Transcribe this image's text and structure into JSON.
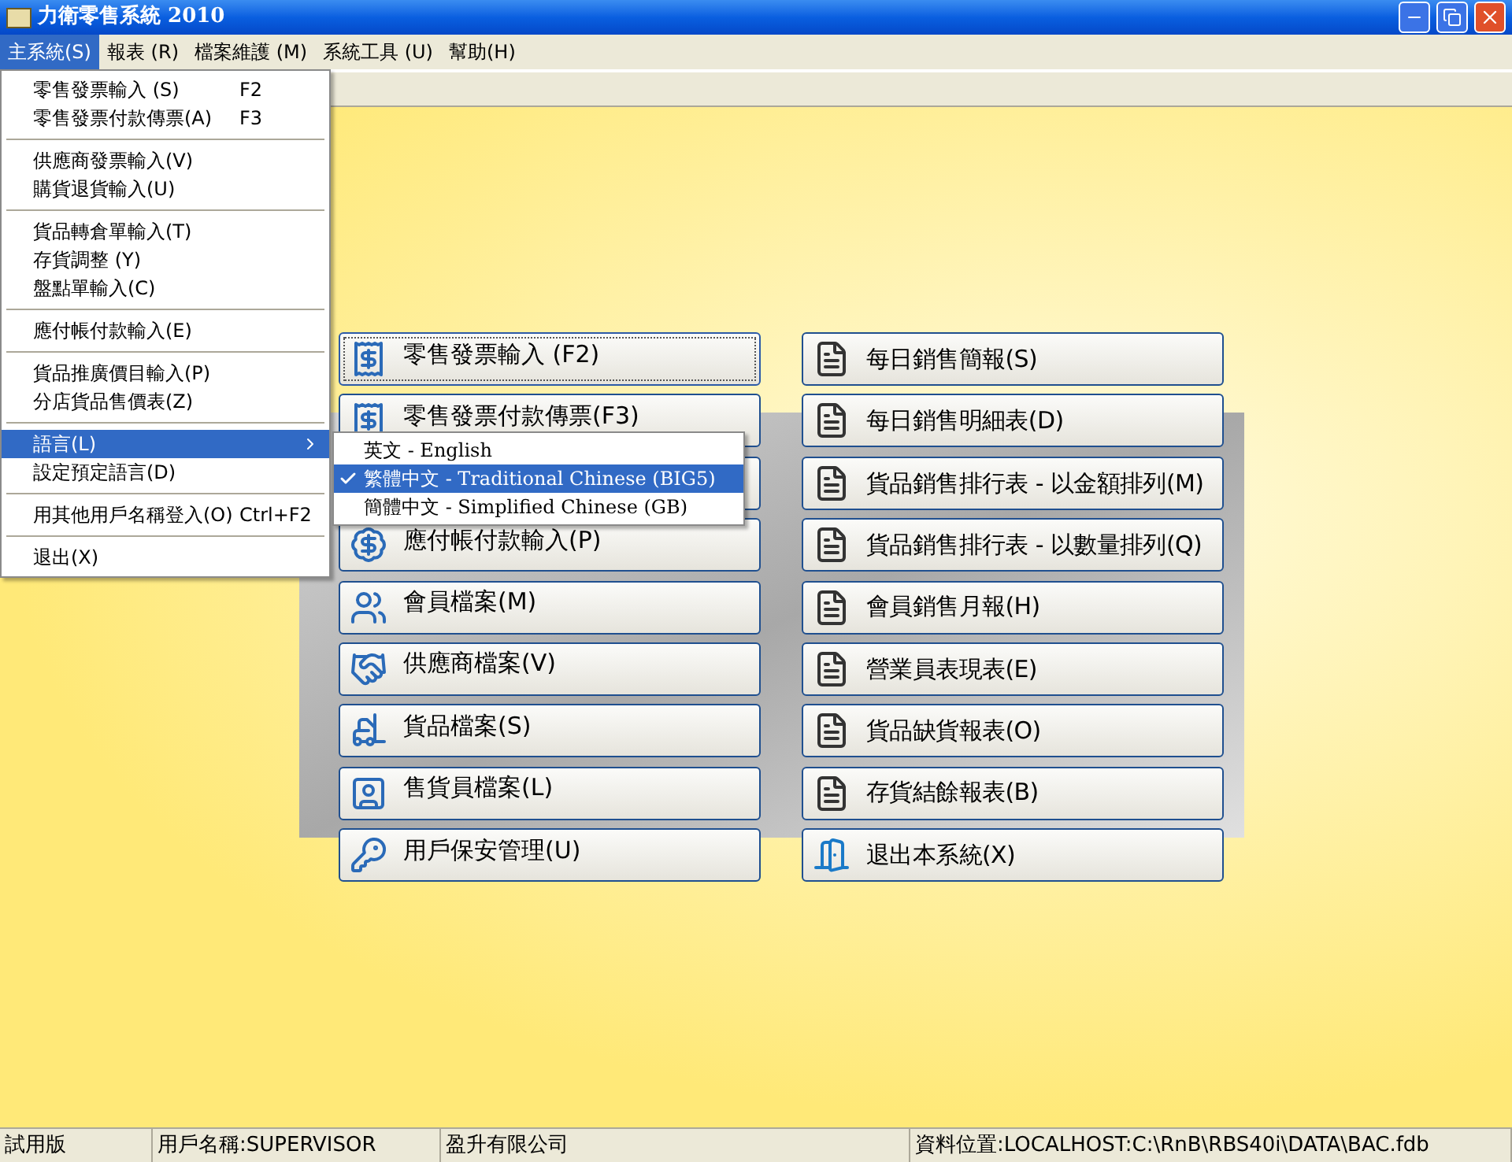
{
  "window": {
    "title": "力衛零售系統 2010"
  },
  "menubar": [
    {
      "label": "主系統(S)",
      "selected": true
    },
    {
      "label": "報表 (R)",
      "selected": false
    },
    {
      "label": "檔案維護 (M)",
      "selected": false
    },
    {
      "label": "系統工具 (U)",
      "selected": false
    },
    {
      "label": "幫助(H)",
      "selected": false
    }
  ],
  "main_menu": {
    "groups": [
      [
        {
          "label": "零售發票輸入 (S)",
          "shortcut": "F2",
          "submenu": false,
          "selected": false
        },
        {
          "label": "零售發票付款傳票(A)",
          "shortcut": "F3",
          "submenu": false,
          "selected": false
        }
      ],
      [
        {
          "label": "供應商發票輸入(V)",
          "submenu": false,
          "selected": false
        },
        {
          "label": "購貨退貨輸入(U)",
          "submenu": false,
          "selected": false
        }
      ],
      [
        {
          "label": "貨品轉倉單輸入(T)",
          "submenu": false,
          "selected": false
        },
        {
          "label": "存貨調整 (Y)",
          "submenu": false,
          "selected": false
        },
        {
          "label": "盤點單輸入(C)",
          "submenu": false,
          "selected": false
        }
      ],
      [
        {
          "label": "應付帳付款輸入(E)",
          "submenu": false,
          "selected": false
        }
      ],
      [
        {
          "label": "貨品推廣價目輸入(P)",
          "submenu": false,
          "selected": false
        },
        {
          "label": "分店貨品售價表(Z)",
          "submenu": false,
          "selected": false
        }
      ],
      [
        {
          "label": "語言(L)",
          "submenu": true,
          "selected": true
        },
        {
          "label": "設定預定語言(D)",
          "submenu": false,
          "selected": false
        }
      ],
      [
        {
          "label": "用其他用戶名稱登入(O)",
          "shortcut": "Ctrl+F2",
          "submenu": false,
          "selected": false
        }
      ],
      [
        {
          "label": "退出(X)",
          "submenu": false,
          "selected": false
        }
      ]
    ]
  },
  "language_submenu": [
    {
      "label": "英文 - English",
      "checked": false,
      "selected": false
    },
    {
      "label": "繁體中文 - Traditional Chinese (BIG5)",
      "checked": true,
      "selected": true
    },
    {
      "label": "簡體中文 - Simplified Chinese (GB)",
      "checked": false,
      "selected": false
    }
  ],
  "left_buttons": [
    {
      "label": "零售發票輸入 (F2)",
      "focused": true
    },
    {
      "label": "零售發票付款傳票(F3)",
      "focused": false
    },
    {
      "focused": false
    },
    {
      "label": "應付帳付款輸入(P)",
      "focused": false
    },
    {
      "label": "會員檔案(M)",
      "focused": false
    },
    {
      "label": "供應商檔案(V)",
      "focused": false
    },
    {
      "label": "貨品檔案(S)",
      "focused": false
    },
    {
      "label": "售貨員檔案(L)",
      "focused": false
    },
    {
      "label": "用戶保安管理(U)",
      "focused": false
    }
  ],
  "right_buttons": [
    {
      "label": "每日銷售簡報(S)"
    },
    {
      "label": "每日銷售明細表(D)"
    },
    {
      "label": "貨品銷售排行表 - 以金額排列(M)"
    },
    {
      "label": "貨品銷售排行表 - 以數量排列(Q)"
    },
    {
      "label": "會員銷售月報(H)"
    },
    {
      "label": "營業員表現表(E)"
    },
    {
      "label": "貨品缺貨報表(O)"
    },
    {
      "label": "存貨結餘報表(B)"
    },
    {
      "label": "退出本系統(X)"
    }
  ],
  "status_bar": [
    "試用版",
    "用戶名稱:SUPERVISOR",
    "盈升有限公司",
    "資料位置:LOCALHOST:C:\\RnB\\RBS40i\\DATA\\BAC.fdb"
  ]
}
